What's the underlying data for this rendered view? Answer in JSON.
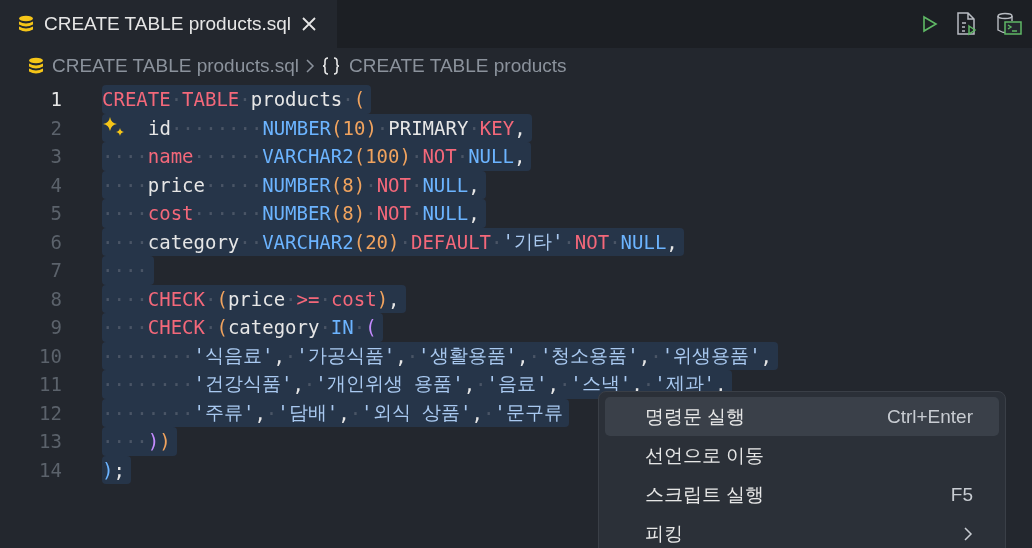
{
  "tab": {
    "title": "CREATE TABLE products.sql",
    "selected": true
  },
  "breadcrumb": [
    {
      "kind": "file",
      "text": "CREATE TABLE products.sql"
    },
    {
      "kind": "symbol",
      "text": "CREATE TABLE products"
    }
  ],
  "editor": {
    "lines": [
      {
        "number": "1",
        "current": true,
        "selected": true,
        "tokens": [
          {
            "text": "CREATE",
            "kind": "kw"
          },
          {
            "text": "·",
            "kind": "ws"
          },
          {
            "text": "TABLE",
            "kind": "kw"
          },
          {
            "text": "·",
            "kind": "ws"
          },
          {
            "text": "products",
            "kind": "id"
          },
          {
            "text": "·",
            "kind": "ws"
          },
          {
            "text": "(",
            "kind": "paren"
          }
        ]
      },
      {
        "number": "2",
        "current": false,
        "selected": true,
        "sparkle": true,
        "tokens": [
          {
            "text": "id",
            "kind": "id"
          },
          {
            "text": "········",
            "kind": "ws"
          },
          {
            "text": "NUMBER",
            "kind": "type"
          },
          {
            "text": "(",
            "kind": "paren"
          },
          {
            "text": "10",
            "kind": "num"
          },
          {
            "text": ")",
            "kind": "paren"
          },
          {
            "text": "·",
            "kind": "ws"
          },
          {
            "text": "PRIMARY",
            "kind": "id"
          },
          {
            "text": "·",
            "kind": "ws"
          },
          {
            "text": "KEY",
            "kind": "kw"
          },
          {
            "text": ",",
            "kind": "punct"
          }
        ]
      },
      {
        "number": "3",
        "current": false,
        "selected": true,
        "tokens": [
          {
            "text": "····",
            "kind": "ws"
          },
          {
            "text": "name",
            "kind": "kw"
          },
          {
            "text": "······",
            "kind": "ws"
          },
          {
            "text": "VARCHAR2",
            "kind": "type"
          },
          {
            "text": "(",
            "kind": "paren"
          },
          {
            "text": "100",
            "kind": "num"
          },
          {
            "text": ")",
            "kind": "paren"
          },
          {
            "text": "·",
            "kind": "ws"
          },
          {
            "text": "NOT",
            "kind": "kw"
          },
          {
            "text": "·",
            "kind": "ws"
          },
          {
            "text": "NULL",
            "kind": "type"
          },
          {
            "text": ",",
            "kind": "punct"
          }
        ]
      },
      {
        "number": "4",
        "current": false,
        "selected": true,
        "tokens": [
          {
            "text": "····",
            "kind": "ws"
          },
          {
            "text": "price",
            "kind": "id"
          },
          {
            "text": "·····",
            "kind": "ws"
          },
          {
            "text": "NUMBER",
            "kind": "type"
          },
          {
            "text": "(",
            "kind": "paren"
          },
          {
            "text": "8",
            "kind": "num"
          },
          {
            "text": ")",
            "kind": "paren"
          },
          {
            "text": "·",
            "kind": "ws"
          },
          {
            "text": "NOT",
            "kind": "kw"
          },
          {
            "text": "·",
            "kind": "ws"
          },
          {
            "text": "NULL",
            "kind": "type"
          },
          {
            "text": ",",
            "kind": "punct"
          }
        ]
      },
      {
        "number": "5",
        "current": false,
        "selected": true,
        "tokens": [
          {
            "text": "····",
            "kind": "ws"
          },
          {
            "text": "cost",
            "kind": "kw"
          },
          {
            "text": "······",
            "kind": "ws"
          },
          {
            "text": "NUMBER",
            "kind": "type"
          },
          {
            "text": "(",
            "kind": "paren"
          },
          {
            "text": "8",
            "kind": "num"
          },
          {
            "text": ")",
            "kind": "paren"
          },
          {
            "text": "·",
            "kind": "ws"
          },
          {
            "text": "NOT",
            "kind": "kw"
          },
          {
            "text": "·",
            "kind": "ws"
          },
          {
            "text": "NULL",
            "kind": "type"
          },
          {
            "text": ",",
            "kind": "punct"
          }
        ]
      },
      {
        "number": "6",
        "current": false,
        "selected": true,
        "tokens": [
          {
            "text": "····",
            "kind": "ws"
          },
          {
            "text": "category",
            "kind": "id"
          },
          {
            "text": "··",
            "kind": "ws"
          },
          {
            "text": "VARCHAR2",
            "kind": "type"
          },
          {
            "text": "(",
            "kind": "paren"
          },
          {
            "text": "20",
            "kind": "num"
          },
          {
            "text": ")",
            "kind": "paren"
          },
          {
            "text": "·",
            "kind": "ws"
          },
          {
            "text": "DEFAULT",
            "kind": "kw"
          },
          {
            "text": "·",
            "kind": "ws"
          },
          {
            "text": "'기타'",
            "kind": "str"
          },
          {
            "text": "·",
            "kind": "ws"
          },
          {
            "text": "NOT",
            "kind": "kw"
          },
          {
            "text": "·",
            "kind": "ws"
          },
          {
            "text": "NULL",
            "kind": "type"
          },
          {
            "text": ",",
            "kind": "punct"
          }
        ]
      },
      {
        "number": "7",
        "current": false,
        "selected": true,
        "tokens": [
          {
            "text": "····",
            "kind": "ws"
          }
        ]
      },
      {
        "number": "8",
        "current": false,
        "selected": true,
        "tokens": [
          {
            "text": "····",
            "kind": "ws"
          },
          {
            "text": "CHECK",
            "kind": "kw"
          },
          {
            "text": "·",
            "kind": "ws"
          },
          {
            "text": "(",
            "kind": "paren"
          },
          {
            "text": "price",
            "kind": "id"
          },
          {
            "text": "·",
            "kind": "ws"
          },
          {
            "text": ">=",
            "kind": "kw"
          },
          {
            "text": "·",
            "kind": "ws"
          },
          {
            "text": "cost",
            "kind": "kw"
          },
          {
            "text": ")",
            "kind": "paren"
          },
          {
            "text": ",",
            "kind": "punct"
          }
        ]
      },
      {
        "number": "9",
        "current": false,
        "selected": true,
        "tokens": [
          {
            "text": "····",
            "kind": "ws"
          },
          {
            "text": "CHECK",
            "kind": "kw"
          },
          {
            "text": "·",
            "kind": "ws"
          },
          {
            "text": "(",
            "kind": "paren"
          },
          {
            "text": "category",
            "kind": "id"
          },
          {
            "text": "·",
            "kind": "ws"
          },
          {
            "text": "IN",
            "kind": "type"
          },
          {
            "text": "·",
            "kind": "ws"
          },
          {
            "text": "(",
            "kind": "paren2"
          }
        ]
      },
      {
        "number": "10",
        "current": false,
        "selected": true,
        "tokens": [
          {
            "text": "········",
            "kind": "ws"
          },
          {
            "text": "'식음료'",
            "kind": "str"
          },
          {
            "text": ",",
            "kind": "punct"
          },
          {
            "text": "·",
            "kind": "ws"
          },
          {
            "text": "'가공식품'",
            "kind": "str"
          },
          {
            "text": ",",
            "kind": "punct"
          },
          {
            "text": "·",
            "kind": "ws"
          },
          {
            "text": "'생활용품'",
            "kind": "str"
          },
          {
            "text": ",",
            "kind": "punct"
          },
          {
            "text": "·",
            "kind": "ws"
          },
          {
            "text": "'청소용품'",
            "kind": "str"
          },
          {
            "text": ",",
            "kind": "punct"
          },
          {
            "text": "·",
            "kind": "ws"
          },
          {
            "text": "'위생용품'",
            "kind": "str"
          },
          {
            "text": ",",
            "kind": "punct"
          }
        ]
      },
      {
        "number": "11",
        "current": false,
        "selected": true,
        "tokens": [
          {
            "text": "········",
            "kind": "ws"
          },
          {
            "text": "'건강식품'",
            "kind": "str"
          },
          {
            "text": ",",
            "kind": "punct"
          },
          {
            "text": "·",
            "kind": "ws"
          },
          {
            "text": "'개인위생 용품'",
            "kind": "str"
          },
          {
            "text": ",",
            "kind": "punct"
          },
          {
            "text": "·",
            "kind": "ws"
          },
          {
            "text": "'음료'",
            "kind": "str"
          },
          {
            "text": ",",
            "kind": "punct"
          },
          {
            "text": "·",
            "kind": "ws"
          },
          {
            "text": "'스낵'",
            "kind": "str"
          },
          {
            "text": ",",
            "kind": "punct"
          },
          {
            "text": "·",
            "kind": "ws"
          },
          {
            "text": "'제과'",
            "kind": "str"
          },
          {
            "text": ",",
            "kind": "punct"
          }
        ]
      },
      {
        "number": "12",
        "current": false,
        "selected": true,
        "tokens": [
          {
            "text": "········",
            "kind": "ws"
          },
          {
            "text": "'주류'",
            "kind": "str"
          },
          {
            "text": ",",
            "kind": "punct"
          },
          {
            "text": "·",
            "kind": "ws"
          },
          {
            "text": "'담배'",
            "kind": "str"
          },
          {
            "text": ",",
            "kind": "punct"
          },
          {
            "text": "·",
            "kind": "ws"
          },
          {
            "text": "'외식 상품'",
            "kind": "str"
          },
          {
            "text": ",",
            "kind": "punct"
          },
          {
            "text": "·",
            "kind": "ws"
          },
          {
            "text": "'문구류",
            "kind": "str"
          }
        ]
      },
      {
        "number": "13",
        "current": false,
        "selected": true,
        "tokens": [
          {
            "text": "····",
            "kind": "ws"
          },
          {
            "text": ")",
            "kind": "paren2"
          },
          {
            "text": ")",
            "kind": "paren"
          }
        ]
      },
      {
        "number": "14",
        "current": false,
        "selected": true,
        "tokens": [
          {
            "text": ")",
            "kind": "paren3"
          },
          {
            "text": ";",
            "kind": "punct"
          }
        ]
      }
    ]
  },
  "context_menu": [
    {
      "label": "명령문 실행",
      "shortcut": "Ctrl+Enter",
      "submenu": false,
      "selected": true
    },
    {
      "label": "선언으로 이동",
      "submenu": false,
      "selected": false
    },
    {
      "label": "스크립트 실행",
      "shortcut": "F5",
      "submenu": false,
      "selected": false
    },
    {
      "label": "피킹",
      "submenu": true,
      "selected": false
    }
  ]
}
